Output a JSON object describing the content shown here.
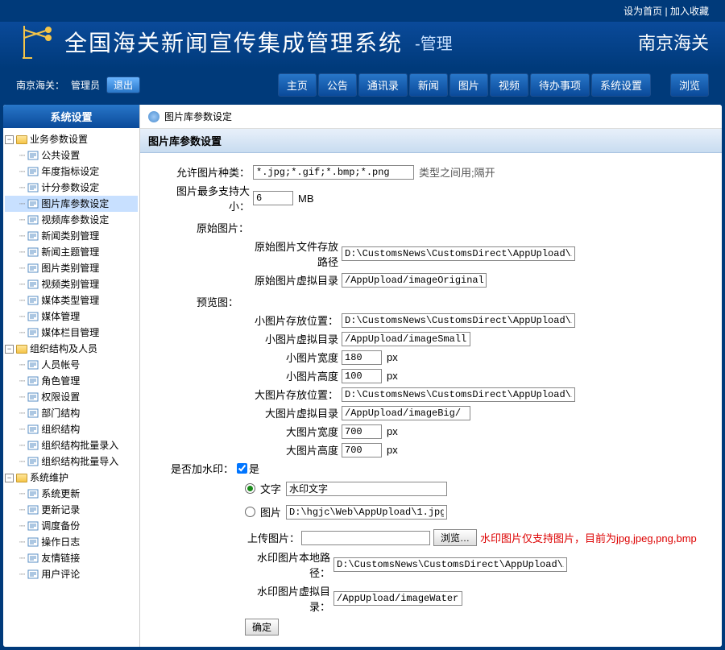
{
  "topLinks": {
    "home": "设为首页",
    "fav": "加入收藏"
  },
  "header": {
    "titleMain": "全国海关新闻宣传集成管理系统",
    "titleSub": "-管理",
    "right": "南京海关"
  },
  "userbar": {
    "org": "南京海关：",
    "role": "管理员",
    "logout": "退出"
  },
  "nav": [
    "主页",
    "公告",
    "通讯录",
    "新闻",
    "图片",
    "视频",
    "待办事项",
    "系统设置",
    "浏览"
  ],
  "sidebar": {
    "title": "系统设置",
    "folders": [
      {
        "name": "业务参数设置",
        "items": [
          "公共设置",
          "年度指标设定",
          "计分参数设定",
          "图片库参数设定",
          "视频库参数设定",
          "新闻类别管理",
          "新闻主题管理",
          "图片类别管理",
          "视频类别管理",
          "媒体类型管理",
          "媒体管理",
          "媒体栏目管理"
        ]
      },
      {
        "name": "组织结构及人员",
        "items": [
          "人员帐号",
          "角色管理",
          "权限设置",
          "部门结构",
          "组织结构",
          "组织结构批量录入",
          "组织结构批量导入"
        ]
      },
      {
        "name": "系统维护",
        "items": [
          "系统更新",
          "更新记录",
          "调度备份",
          "操作日志",
          "友情链接",
          "用户评论"
        ]
      }
    ]
  },
  "breadcrumb": "图片库参数设定",
  "sectionTitle": "图片库参数设置",
  "form": {
    "allowTypesLabel": "允许图片种类：",
    "allowTypes": "*.jpg;*.gif;*.bmp;*.png",
    "allowTypesHint": "类型之间用;隔开",
    "maxSizeLabel": "图片最多支持大小：",
    "maxSize": "6",
    "maxSizeUnit": "MB",
    "origHeader": "原始图片：",
    "origPathLabel": "原始图片文件存放路径",
    "origPath": "D:\\CustomsNews\\CustomsDirect\\AppUpload\\imag",
    "origVirtLabel": "原始图片虚拟目录",
    "origVirt": "/AppUpload/imageOriginal/",
    "previewHeader": "预览图：",
    "smallPathLabel": "小图片存放位置：",
    "smallPath": "D:\\CustomsNews\\CustomsDirect\\AppUpload\\imag",
    "smallVirtLabel": "小图片虚拟目录",
    "smallVirt": "/AppUpload/imageSmall/",
    "smallWLabel": "小图片宽度",
    "smallW": "180",
    "smallHLabel": "小图片高度",
    "smallH": "100",
    "bigPathLabel": "大图片存放位置：",
    "bigPath": "D:\\CustomsNews\\CustomsDirect\\AppUpload\\imag",
    "bigVirtLabel": "大图片虚拟目录",
    "bigVirt": "/AppUpload/imageBig/",
    "bigWLabel": "大图片宽度",
    "bigW": "700",
    "bigHLabel": "大图片高度",
    "bigH": "700",
    "pxUnit": "px",
    "watermarkLabel": "是否加水印：",
    "watermarkYes": "是",
    "wmTextLabel": "文字",
    "wmText": "水印文字",
    "wmImgLabel": "图片",
    "wmImg": "D:\\hgjc\\Web\\AppUpload\\1.jpg",
    "uploadLabel": "上传图片：",
    "browseBtn": "浏览…",
    "uploadHint": "水印图片仅支持图片，目前为jpg,jpeg,png,bmp",
    "wmLocalLabel": "水印图片本地路径：",
    "wmLocal": "D:\\CustomsNews\\CustomsDirect\\AppUpload\\imag",
    "wmVirtLabel": "水印图片虚拟目录：",
    "wmVirt": "/AppUpload/imageWater/",
    "submit": "确定"
  }
}
